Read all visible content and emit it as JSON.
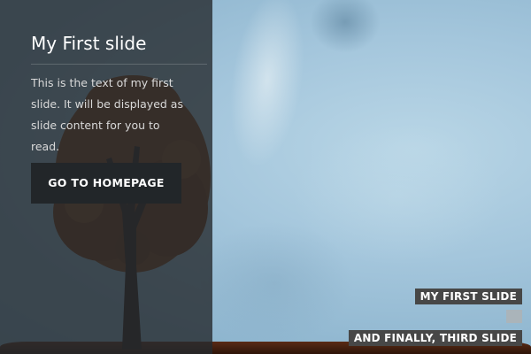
{
  "slide": {
    "title": "My First slide",
    "text": "This is the text of my first slide. It will be displayed as slide content for you to read.",
    "cta_label": "GO TO HOMEPAGE"
  },
  "slide_nav": {
    "items": [
      {
        "label": "MY FIRST SLIDE"
      },
      {
        "label": ""
      },
      {
        "label": "AND FINALLY, THIRD SLIDE"
      }
    ]
  },
  "colors": {
    "sky": "#a4c6dc",
    "panel": "#262a2e",
    "button": "#222629",
    "label_bg": "#474747",
    "tree_foliage": "#7b3d17",
    "ground": "#4a2312"
  }
}
